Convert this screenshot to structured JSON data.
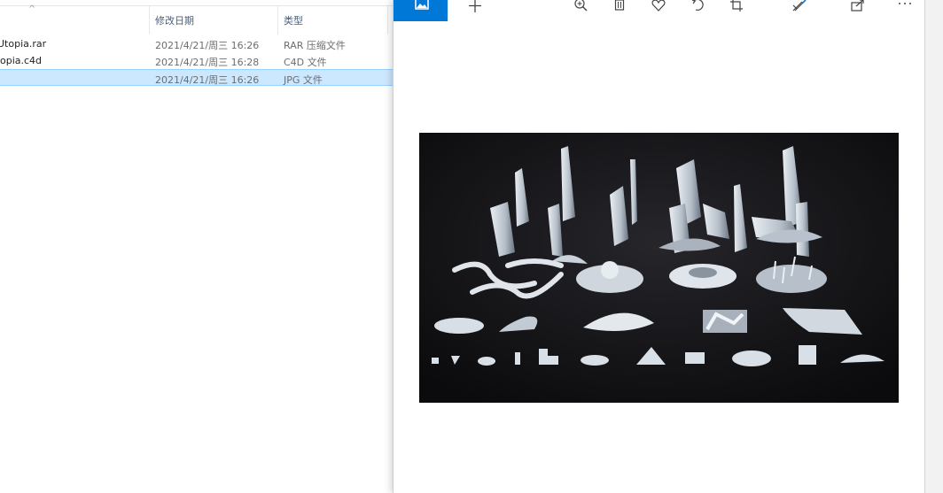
{
  "explorer": {
    "columns": {
      "date": "修改日期",
      "type": "类型"
    },
    "files": [
      {
        "name": "Utopia.rar",
        "date": "2021/4/21/周三 16:26",
        "type": "RAR 压缩文件",
        "selected": false
      },
      {
        "name": "opia.c4d",
        "date": "2021/4/21/周三 16:28",
        "type": "C4D 文件",
        "selected": false
      },
      {
        "name": "",
        "date": "2021/4/21/周三 16:26",
        "type": "JPG 文件",
        "selected": true
      }
    ]
  },
  "viewer": {
    "toolbar_icons": [
      "image-icon",
      "add-icon",
      "zoom-icon",
      "delete-icon",
      "favorite-icon",
      "rotate-icon",
      "crop-icon",
      "edit-enhance-icon",
      "share-icon",
      "more-icon"
    ],
    "accent": "#0078d7",
    "photo_subject": "white futuristic architectural models on black background"
  }
}
